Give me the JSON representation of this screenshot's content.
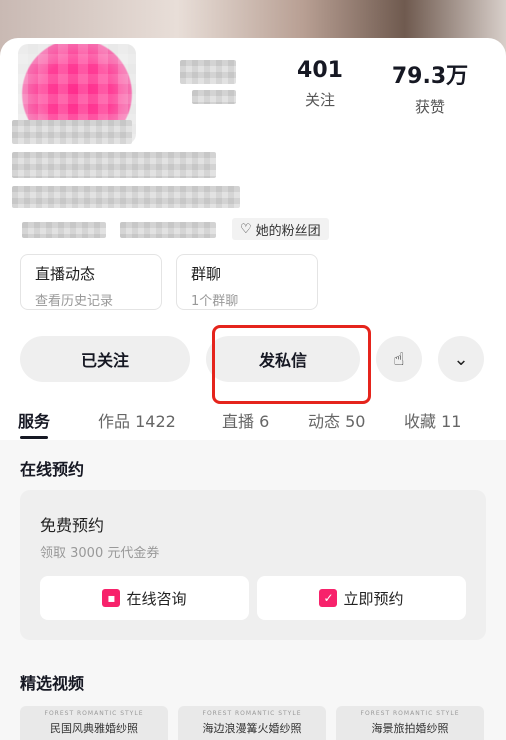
{
  "profile": {
    "stats": [
      {
        "value": "401",
        "label": "关注"
      },
      {
        "value": "79.3万",
        "label": "获赞"
      }
    ],
    "fan_club": "她的粉丝团"
  },
  "quick_cards": [
    {
      "title": "直播动态",
      "subtitle": "查看历史记录"
    },
    {
      "title": "群聊",
      "subtitle": "1个群聊"
    }
  ],
  "actions": {
    "following": "已关注",
    "message": "发私信"
  },
  "tabs": [
    {
      "label": "服务",
      "active": true
    },
    {
      "label": "作品 1422"
    },
    {
      "label": "直播 6"
    },
    {
      "label": "动态 50"
    },
    {
      "label": "收藏 11"
    }
  ],
  "booking": {
    "section_title": "在线预约",
    "title": "免费预约",
    "subtitle": "领取 3000 元代金券",
    "consult_label": "在线咨询",
    "book_label": "立即预约"
  },
  "featured": {
    "section_title": "精选视频",
    "videos": [
      {
        "caption": "FOREST ROMANTIC STYLE",
        "title": "民国风典雅婚纱照"
      },
      {
        "caption": "FOREST ROMANTIC STYLE",
        "title": "海边浪漫篝火婚纱照"
      },
      {
        "caption": "FOREST ROMANTIC STYLE",
        "title": "海景旅拍婚纱照"
      }
    ]
  },
  "colors": {
    "accent_pink": "#f7226b",
    "highlight_red": "#e5241c"
  }
}
